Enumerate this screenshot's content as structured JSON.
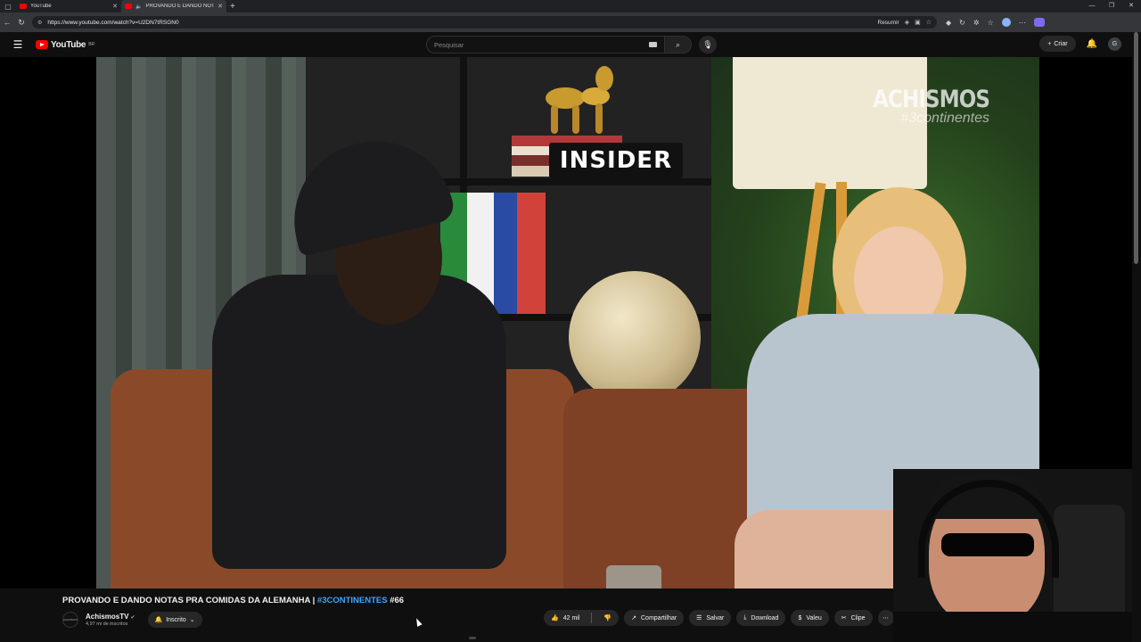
{
  "browser": {
    "tabs": [
      {
        "title": "YouTube",
        "active": false
      },
      {
        "title": "PROVANDO E DANDO NOTAS",
        "active": true
      }
    ],
    "url": "https://www.youtube.com/watch?v=U2DN7tRSGN0",
    "summarize_label": "Resumir"
  },
  "youtube": {
    "logo_text": "YouTube",
    "region_code": "BR",
    "search_placeholder": "Pesquisar",
    "create_label": "Criar",
    "avatar_initial": "G"
  },
  "video": {
    "watermark_title": "ACHISMOS",
    "watermark_subtitle": "#3continentes",
    "sign_text": "INSIDER"
  },
  "info": {
    "title_prefix": "PROVANDO E DANDO NOTAS PRA COMIDAS DA ALEMANHA | ",
    "title_tag": "#3CONTINENTES",
    "title_suffix": " #66",
    "channel_name": "AchismosTV",
    "channel_subs": "4,97 mi de inscritos",
    "subscribe_label": "Inscrito",
    "like_count": "42 mil",
    "share_label": "Compartilhar",
    "save_label": "Salvar",
    "download_label": "Download",
    "thanks_label": "Valeu",
    "clip_label": "Clipe"
  },
  "colors": {
    "youtube_red": "#ff0000",
    "link_blue": "#3ea6ff",
    "background": "#0f0f0f"
  }
}
